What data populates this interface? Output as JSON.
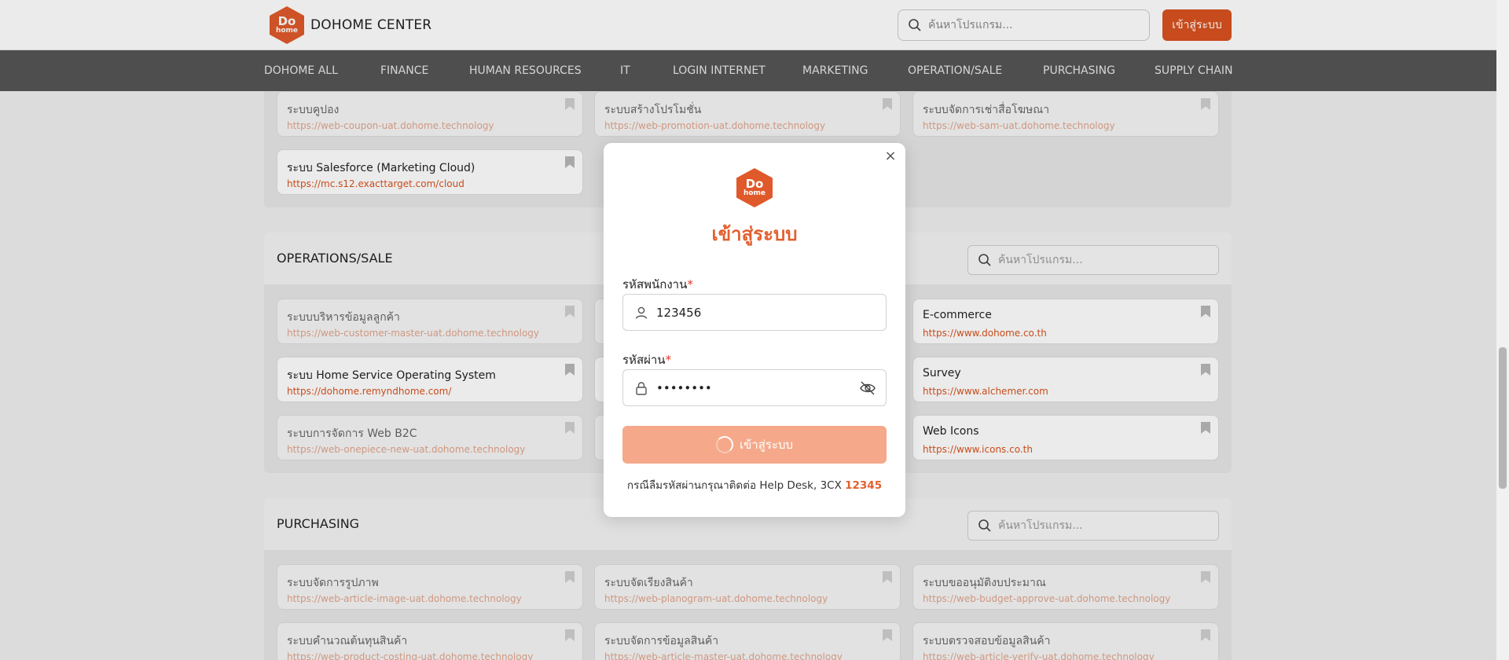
{
  "header": {
    "logo_do": "Do",
    "logo_home": "home",
    "brand": "DOHOME CENTER",
    "search_placeholder": "ค้นหาโปรแกรม...",
    "login_label": "เข้าสู่ระบบ"
  },
  "nav": [
    "DOHOME ALL",
    "FINANCE",
    "HUMAN RESOURCES",
    "IT",
    "LOGIN INTERNET",
    "MARKETING",
    "OPERATION/SALE",
    "PURCHASING",
    "SUPPLY CHAIN"
  ],
  "marketing": {
    "cards": [
      {
        "title": "ระบบคูปอง",
        "url": "https://web-coupon-uat.dohome.technology"
      },
      {
        "title": "ระบบสร้างโปรโมชั่น",
        "url": "https://web-promotion-uat.dohome.technology"
      },
      {
        "title": "ระบบจัดการเช่าสื่อโฆษณา",
        "url": "https://web-sam-uat.dohome.technology"
      },
      {
        "title": "ระบบ Salesforce (Marketing Cloud)",
        "url": "https://mc.s12.exacttarget.com/cloud"
      }
    ]
  },
  "operations": {
    "title": "OPERATIONS/SALE",
    "search_placeholder": "ค้นหาโปรแกรม...",
    "cards": [
      {
        "title": "ระบบบริหารข้อมูลลูกค้า",
        "url": "https://web-customer-master-uat.dohome.technology"
      },
      {
        "title": "E-commerce",
        "url": "https://www.dohome.co.th"
      },
      {
        "title": "ระบบ Home Service Operating System",
        "url": "https://dohome.remyndhome.com/"
      },
      {
        "title": "Survey",
        "url": "https://www.alchemer.com"
      },
      {
        "title": "ระบบการจัดการ Web B2C",
        "url": "https://web-onepiece-new-uat.dohome.technology"
      },
      {
        "title": "Web Icons",
        "url": "https://www.icons.co.th"
      }
    ]
  },
  "purchasing": {
    "title": "PURCHASING",
    "search_placeholder": "ค้นหาโปรแกรม...",
    "cards": [
      {
        "title": "ระบบจัดการรูปภาพ",
        "url": "https://web-article-image-uat.dohome.technology"
      },
      {
        "title": "ระบบจัดเรียงสินค้า",
        "url": "https://web-planogram-uat.dohome.technology"
      },
      {
        "title": "ระบบขออนุมัติงบประมาณ",
        "url": "https://web-budget-approve-uat.dohome.technology"
      },
      {
        "title": "ระบบคำนวณต้นทุนสินค้า",
        "url": "https://web-product-costing-uat.dohome.technology"
      },
      {
        "title": "ระบบจัดการข้อมูลสินค้า",
        "url": "https://web-article-master-uat.dohome.technology"
      },
      {
        "title": "ระบบตรวจสอบข้อมูลสินค้า",
        "url": "https://web-article-verify-uat.dohome.technology"
      }
    ]
  },
  "modal": {
    "close": "×",
    "logo_do": "Do",
    "logo_home": "home",
    "title": "เข้าสู่ระบบ",
    "employee_label": "รหัสพนักงาน",
    "required_mark": "*",
    "employee_value": "123456",
    "password_label": "รหัสผ่าน",
    "password_value": "••••••••",
    "submit_label": "เข้าสู่ระบบ",
    "help_text": "กรณีลืมรหัสผ่านกรุณาติดต่อ Help Desk, 3CX ",
    "help_number": "12345"
  }
}
